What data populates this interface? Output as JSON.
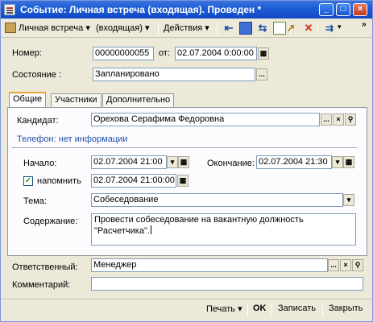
{
  "window": {
    "title": "Событие: Личная встреча (входящая). Проведен *",
    "controls": {
      "minimize": "_",
      "maximize": "□",
      "close": "×"
    }
  },
  "toolbar": {
    "event_type": "Личная встреча",
    "direction": "(входящая)",
    "actions": "Действия",
    "icons": [
      "move-prev-icon",
      "refresh-icon",
      "filter-icon",
      "copy-icon",
      "open-icon",
      "delete-icon",
      "navigate-icon"
    ],
    "more": "»"
  },
  "header": {
    "number_label": "Номер:",
    "number_value": "00000000055",
    "date_label": "от:",
    "date_value": "02.07.2004  0:00:00",
    "state_label": "Состояние :",
    "state_value": "Запланировано"
  },
  "tabs": [
    {
      "label": "Общие"
    },
    {
      "label": "Участники"
    },
    {
      "label": "Дополнительно"
    }
  ],
  "general": {
    "candidate_label": "Кандидат:",
    "candidate_value": "Орехова Серафима Федоровна",
    "phone_text": "Телефон: нет информации",
    "start_label": "Начало:",
    "start_value": "02.07.2004 21:00",
    "end_label": "Окончание:",
    "end_value": "02.07.2004 21:30",
    "remind_label": "напомнить",
    "remind_checked": true,
    "remind_value": "02.07.2004 21:00:00",
    "topic_label": "Тема:",
    "topic_value": "Собеседование",
    "content_label": "Содержание:",
    "content_line1": "Провести собеседование на вакантную должность",
    "content_line2": "\"Расчетчика\"."
  },
  "footer": {
    "responsible_label": "Ответственный:",
    "responsible_value": "Менеджер",
    "comment_label": "Комментарий:",
    "comment_value": ""
  },
  "bottom": {
    "print": "Печать",
    "ok": "OK",
    "save": "Записать",
    "close": "Закрыть"
  },
  "colors": {
    "titlebar": "#1d5fd6",
    "window_bg": "#ece9d8",
    "active_tab_accent": "#e8a23a",
    "phone_text": "#1f4fa8"
  }
}
